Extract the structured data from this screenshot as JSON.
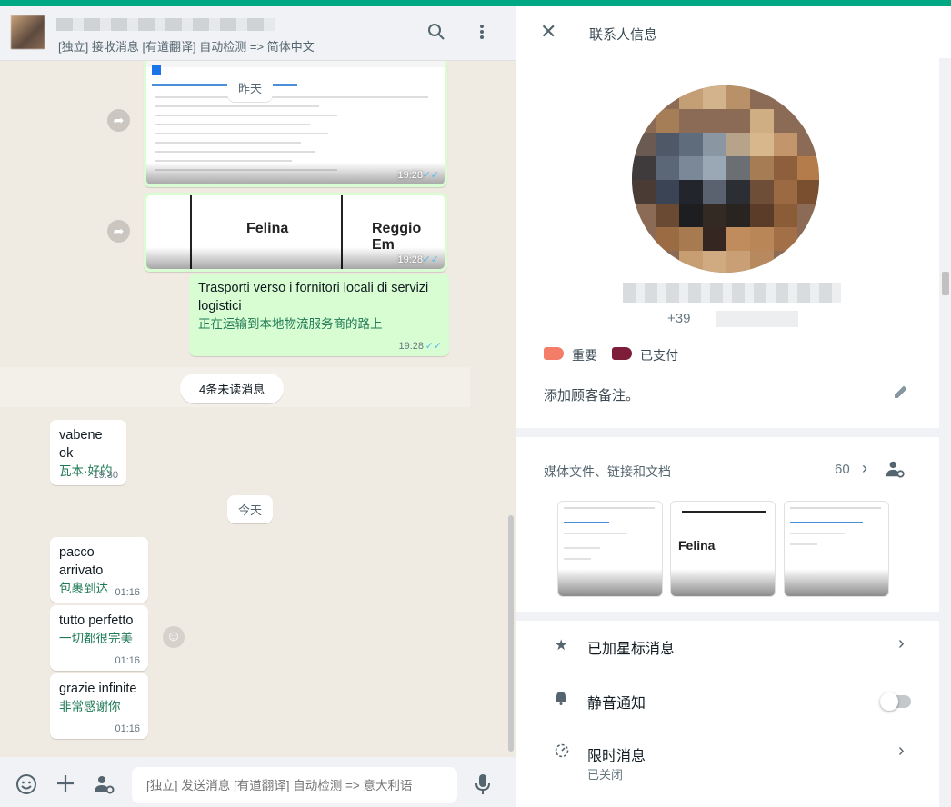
{
  "chat": {
    "status": "[独立] 接收消息 [有道翻译] 自动检测 => 简体中文"
  },
  "messages": {
    "img1_time": "19:28",
    "img1_ticks": "✓✓",
    "yesterday": "昨天",
    "img2_text_a": "Felina",
    "img2_text_b": "Reggio Em",
    "img2_time": "19:28",
    "img2_ticks": "✓✓",
    "out1_text": "Trasporti verso i fornitori locali di servizi logistici",
    "out1_trans": "正在运输到本地物流服务商的路上",
    "out1_time": "19:28",
    "out1_ticks": "✓✓",
    "unread": "4条未读消息",
    "in1_text": "vabene ok",
    "in1_trans": "瓦本·好的",
    "in1_time": "19:30",
    "today": "今天",
    "in2_text": "pacco arrivato",
    "in2_trans": "包裹到达",
    "in2_time": "01:16",
    "in3_text": "tutto perfetto",
    "in3_trans": "一切都很完美",
    "in3_time": "01:16",
    "in4_text": "grazie infinite",
    "in4_trans": "非常感谢你",
    "in4_time": "01:16"
  },
  "footer": {
    "compose_placeholder": "[独立] 发送消息 [有道翻译] 自动检测 => 意大利语"
  },
  "contact": {
    "panel_title": "联系人信息",
    "phone_prefix": "+39",
    "labels": [
      {
        "text": "重要",
        "color": "#f47d6a"
      },
      {
        "text": "已支付",
        "color": "#7d1d3a"
      }
    ],
    "note": "添加顾客备注。",
    "media_title": "媒体文件、链接和文档",
    "media_count": "60",
    "media_thumb2_text": "Felina",
    "starred": "已加星标消息",
    "mute": "静音通知",
    "disappearing": "限时消息",
    "disappearing_sub": "已关闭"
  },
  "colors": {
    "accent": "#00a884",
    "outgoing_bubble": "#d9fdd3",
    "translation_text": "#1f7a55",
    "read_ticks": "#53bdeb"
  }
}
